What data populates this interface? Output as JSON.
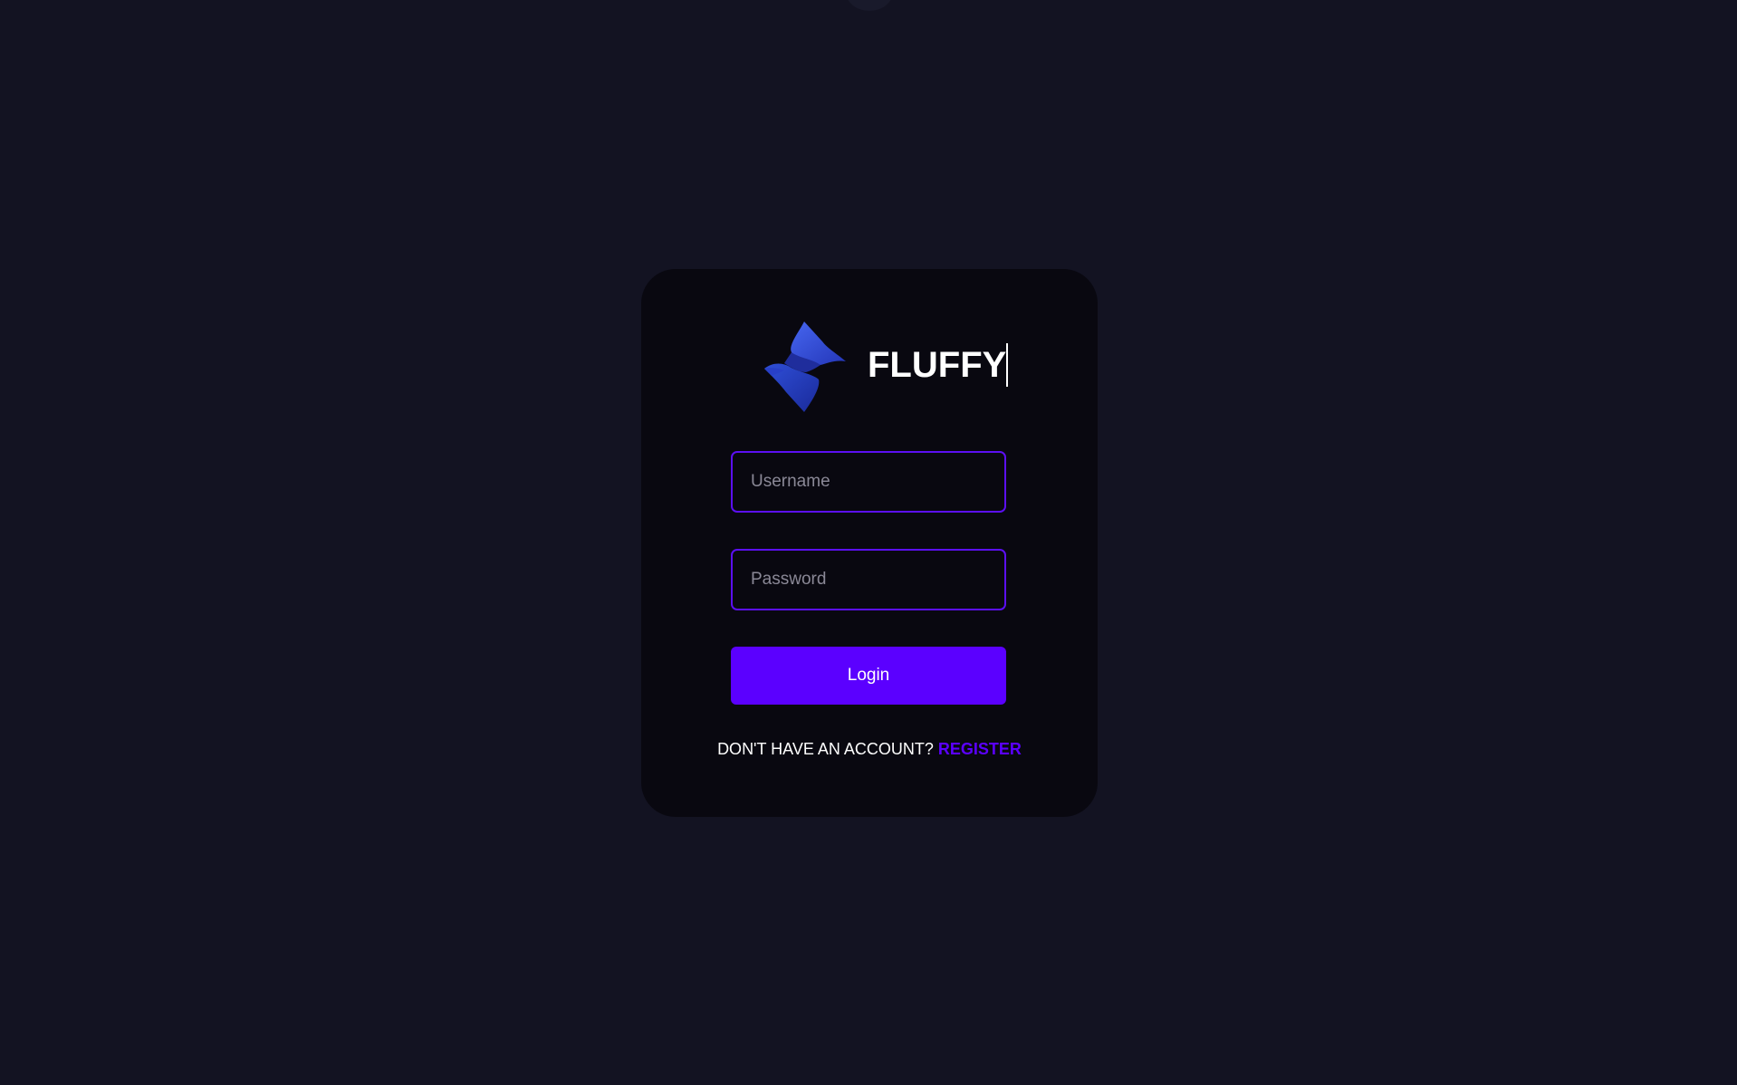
{
  "app": {
    "brand_name": "FLUFFY",
    "logo_icon": "s-diamond-logo-icon"
  },
  "login_form": {
    "username_placeholder": "Username",
    "username_value": "",
    "password_placeholder": "Password",
    "password_value": "",
    "login_label": "Login"
  },
  "signup_prompt": {
    "text": "DON'T HAVE AN ACCOUNT?",
    "link_label": "REGISTER"
  },
  "colors": {
    "background": "#131322",
    "card": "#090810",
    "accent": "#5b00ff",
    "field_border": "#5b0ff2",
    "text": "#ffffff"
  }
}
